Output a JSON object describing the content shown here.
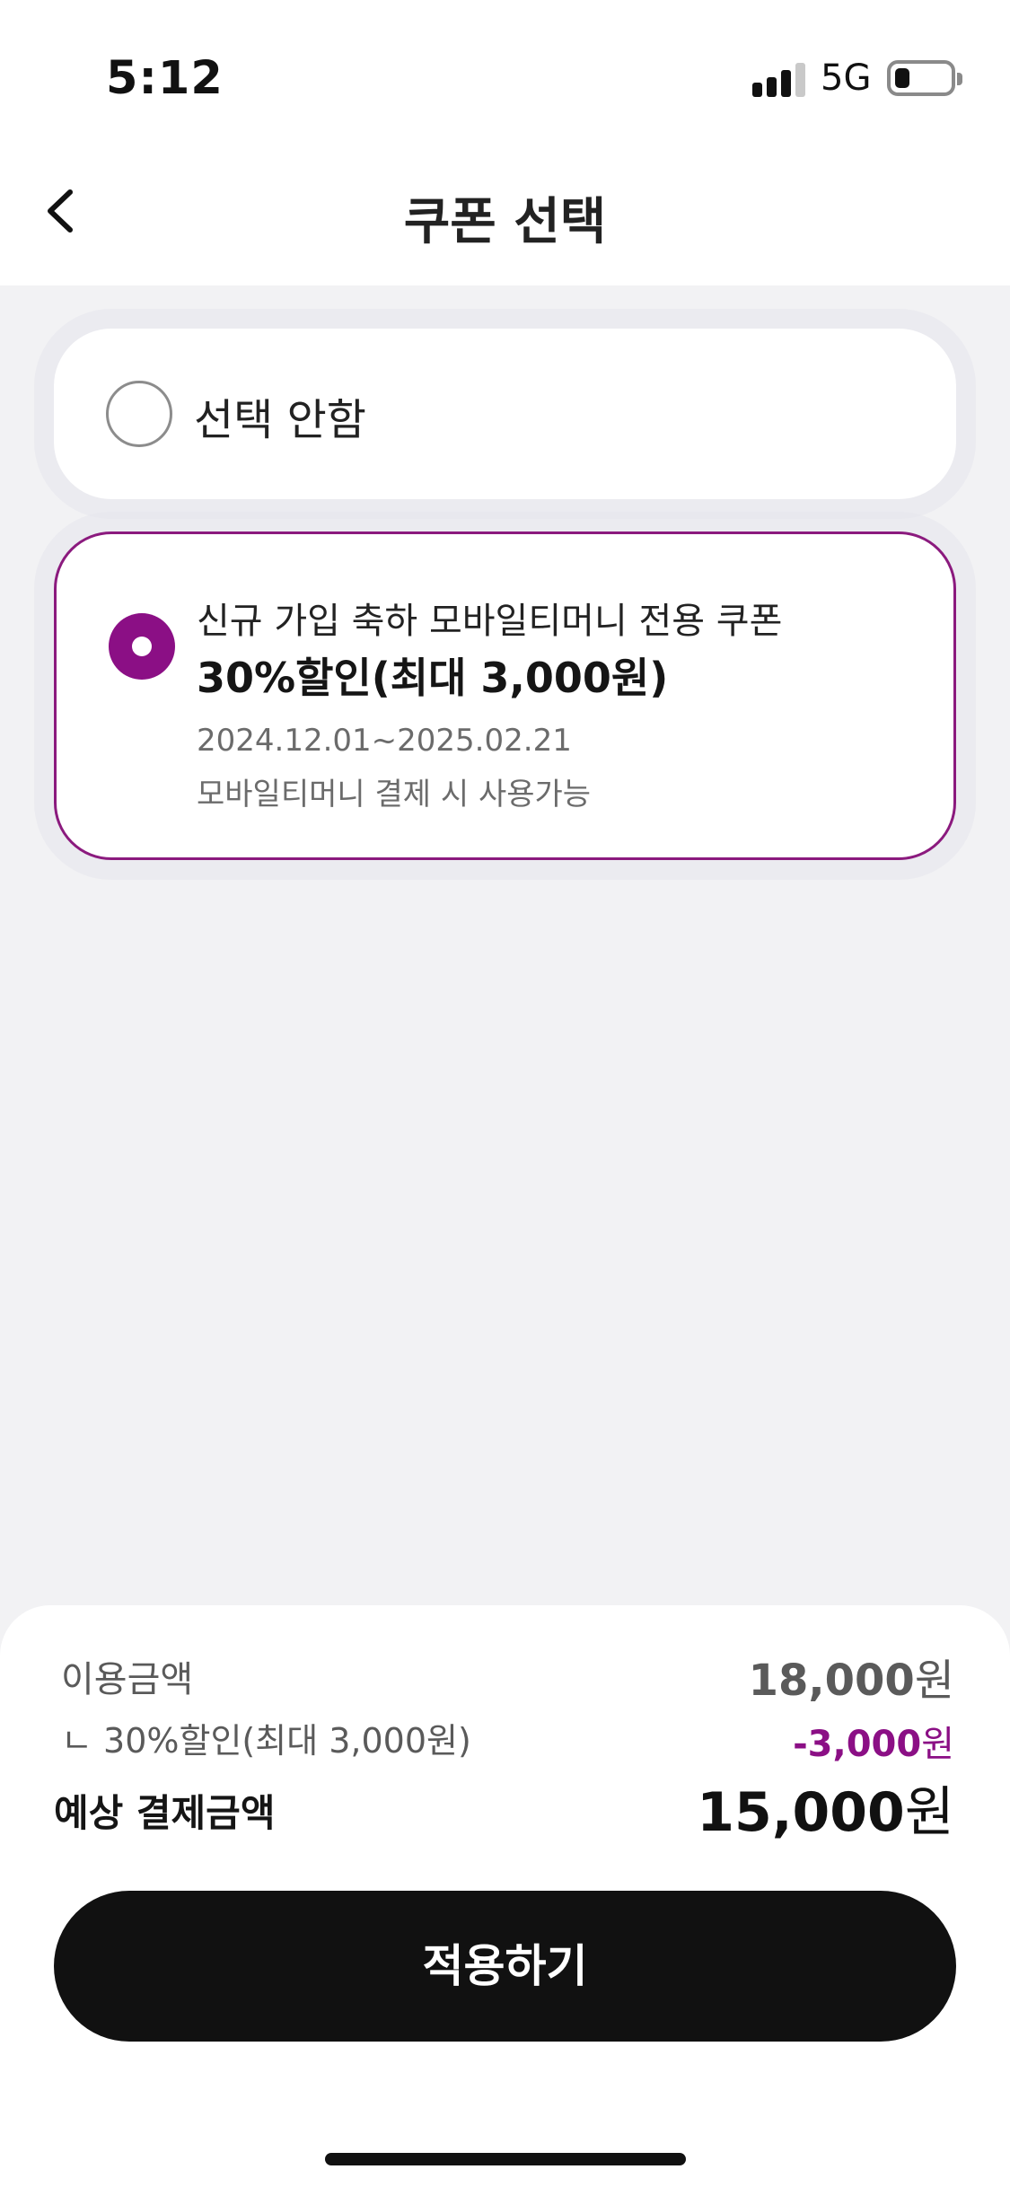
{
  "status_bar": {
    "time": "5:12",
    "network": "5G",
    "signal_bars_active": 3,
    "signal_bars_total": 4,
    "battery_level": 0.25
  },
  "header": {
    "title": "쿠폰 선택",
    "back_icon": "chevron-left-icon"
  },
  "options": {
    "none": {
      "label": "선택 안함",
      "selected": false
    },
    "coupon": {
      "title": "신규 가입 축하 모바일티머니 전용 쿠폰",
      "discount": "30%할인(최대 3,000원)",
      "period": "2024.12.01~2025.02.21",
      "condition": "모바일티머니 결제 시 사용가능",
      "selected": true
    }
  },
  "summary": {
    "usage_label": "이용금액",
    "usage_amount": "18,000",
    "usage_unit": "원",
    "discount_label": "ㄴ 30%할인(최대 3,000원)",
    "discount_amount": "-3,000",
    "discount_unit": "원",
    "total_label": "예상 결제금액",
    "total_amount": "15,000",
    "total_unit": "원"
  },
  "apply_button": {
    "label": "적용하기"
  },
  "colors": {
    "accent": "#8b0f85",
    "background": "#f2f2f4",
    "button": "#111111"
  }
}
